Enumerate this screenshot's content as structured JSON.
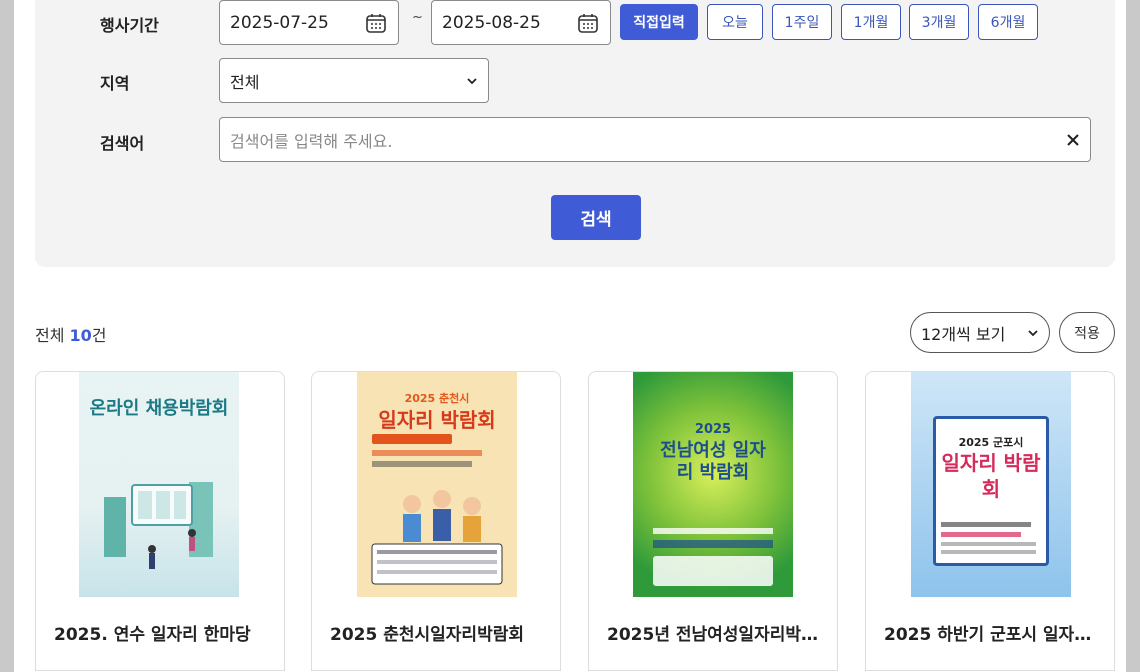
{
  "filters": {
    "period_label": "행사기간",
    "start_date": "2025-07-25",
    "end_date": "2025-08-25",
    "date_separator": "~",
    "period_buttons": [
      "직접입력",
      "오늘",
      "1주일",
      "1개월",
      "3개월",
      "6개월"
    ],
    "region_label": "지역",
    "region_value": "전체",
    "keyword_label": "검색어",
    "keyword_placeholder": "검색어를 입력해 주세요.",
    "search_button": "검색"
  },
  "results": {
    "total_prefix": "전체 ",
    "total_count": "10",
    "total_suffix": "건",
    "per_page_value": "12개씩 보기",
    "apply_button": "적용"
  },
  "cards": [
    {
      "title": "2025. 연수 일자리 한마당",
      "poster_title": "온라인 채용박람회"
    },
    {
      "title": "2025 춘천시일자리박람회",
      "poster_sub": "2025 춘천시",
      "poster_title": "일자리 박람회"
    },
    {
      "title": "2025년 전남여성일자리박…",
      "poster_sub": "2025",
      "poster_title": "전남여성 일자리 박람회"
    },
    {
      "title": "2025 하반기 군포시 일자…",
      "poster_sub": "2025 군포시",
      "poster_title": "일자리 박람회"
    }
  ],
  "colors": {
    "accent": "#3f5bd6",
    "panel": "#f3f3f3"
  }
}
